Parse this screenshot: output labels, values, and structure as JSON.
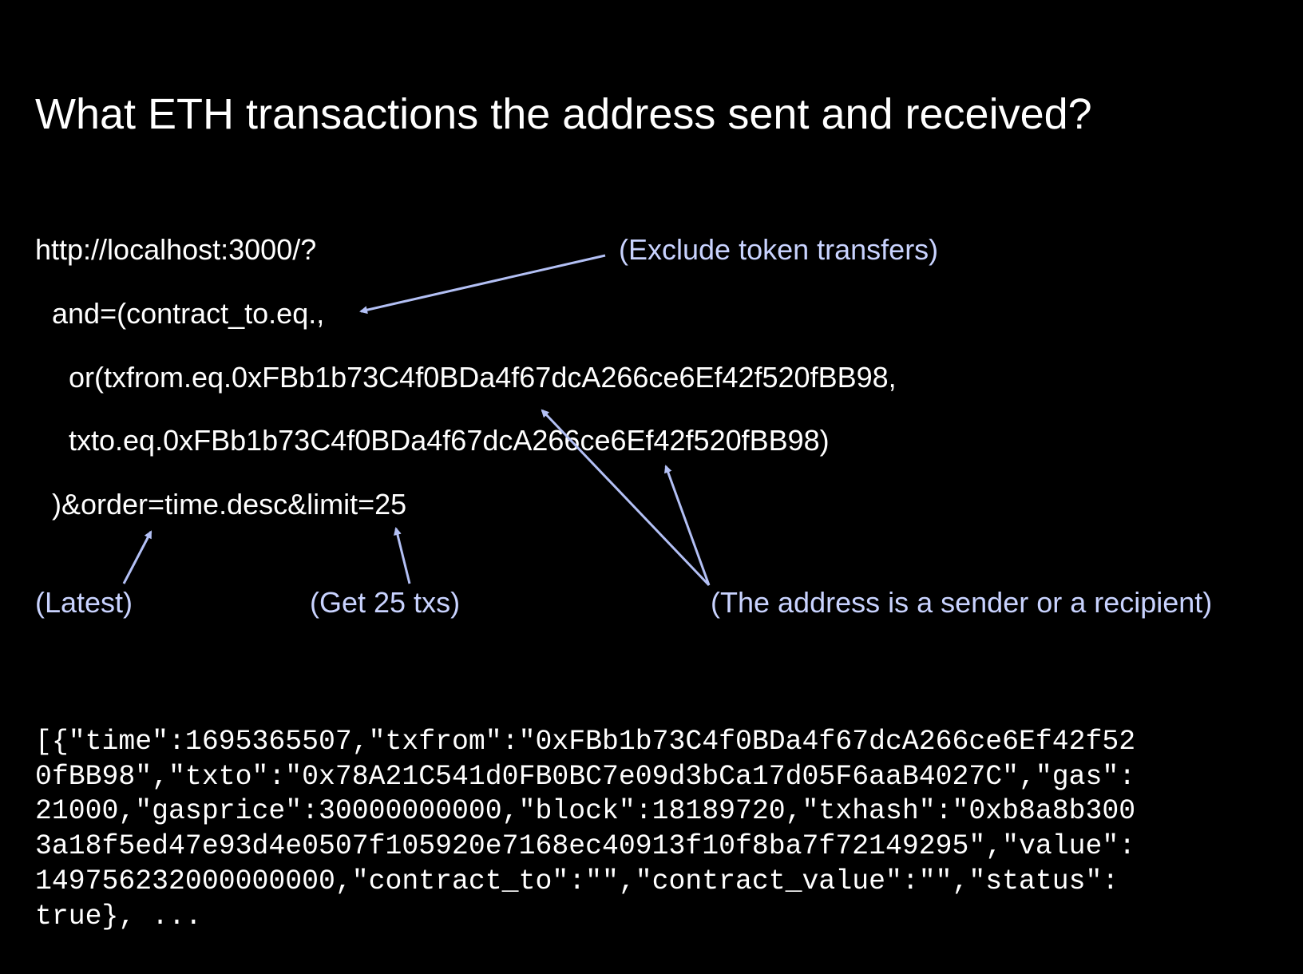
{
  "title": "What ETH transactions the address sent and received?",
  "query": {
    "line1": "http://localhost:3000/?",
    "line2": "and=(contract_to.eq.,",
    "line3": "or(txfrom.eq.0xFBb1b73C4f0BDa4f67dcA266ce6Ef42f520fBB98,",
    "line4": "txto.eq.0xFBb1b73C4f0BDa4f67dcA266ce6Ef42f520fBB98)",
    "line5": ")&order=time.desc&limit=25"
  },
  "annotations": {
    "exclude_tokens": "(Exclude token transfers)",
    "latest": "(Latest)",
    "get_25": "(Get 25 txs)",
    "sender_or_recipient": "(The address is a sender or a recipient)"
  },
  "response": {
    "line1": "[{\"time\":1695365507,\"txfrom\":\"0xFBb1b73C4f0BDa4f67dcA266ce6Ef42f52",
    "line2": "0fBB98\",\"txto\":\"0x78A21C541d0FB0BC7e09d3bCa17d05F6aaB4027C\",\"gas\":",
    "line3": "21000,\"gasprice\":30000000000,\"block\":18189720,\"txhash\":\"0xb8a8b300",
    "line4": "3a18f5ed47e93d4e0507f105920e7168ec40913f10f8ba7f72149295\",\"value\":",
    "line5": "149756232000000000,\"contract_to\":\"\",\"contract_value\":\"\",\"status\":",
    "line6": "true}, ..."
  },
  "colors": {
    "background": "#000000",
    "text": "#ffffff",
    "annotation": "#c9d3ff",
    "arrow": "#b3c0f5"
  }
}
